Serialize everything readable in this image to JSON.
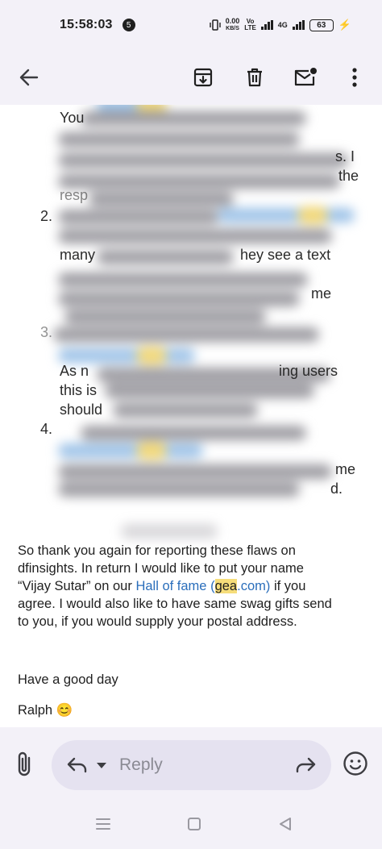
{
  "status": {
    "time": "15:58:03",
    "notification_count": "5",
    "net_speed_value": "0.00",
    "net_speed_unit": "KB/S",
    "volte_top": "Vo",
    "volte_bottom": "LTE",
    "network_type": "4G",
    "battery": "63"
  },
  "toolbar": {
    "back": "arrow-left-icon",
    "archive": "archive-icon",
    "delete": "trash-icon",
    "mark_unread": "mail-unread-icon",
    "more": "more-vert-icon"
  },
  "message": {
    "list_numbers": [
      "2.",
      "3.",
      "4."
    ],
    "leaked_fragments": [
      "You",
      "s. I",
      "the",
      "resp",
      "many",
      "hey see a text",
      "me",
      "As n",
      "ing users",
      "this is",
      "should",
      "me",
      "d."
    ],
    "thanks_line1": "So thank you again for reporting these flaws on",
    "thanks_line2": "dfinsights. In return I would like to put your name",
    "thanks_line3_a": "“Vijay Sutar” on our ",
    "hall_of_fame_link": "Hall of fame",
    "hall_of_fame_open": " (",
    "domain_highlight": "gea",
    "domain_suffix": ".com",
    "hall_of_fame_close": ")",
    "thanks_line3_b": " if you",
    "thanks_line4": "agree. I would also like to have same swag gifts send",
    "thanks_line5": "to you, if you would supply your postal address.",
    "closing": "Have a good day",
    "signature": "Ralph",
    "signature_emoji": "😊"
  },
  "reply_bar": {
    "placeholder": "Reply"
  },
  "colors": {
    "link": "#2a6ebb",
    "highlight": "#f6dd7a",
    "battery_bolt": "#f5a623"
  }
}
